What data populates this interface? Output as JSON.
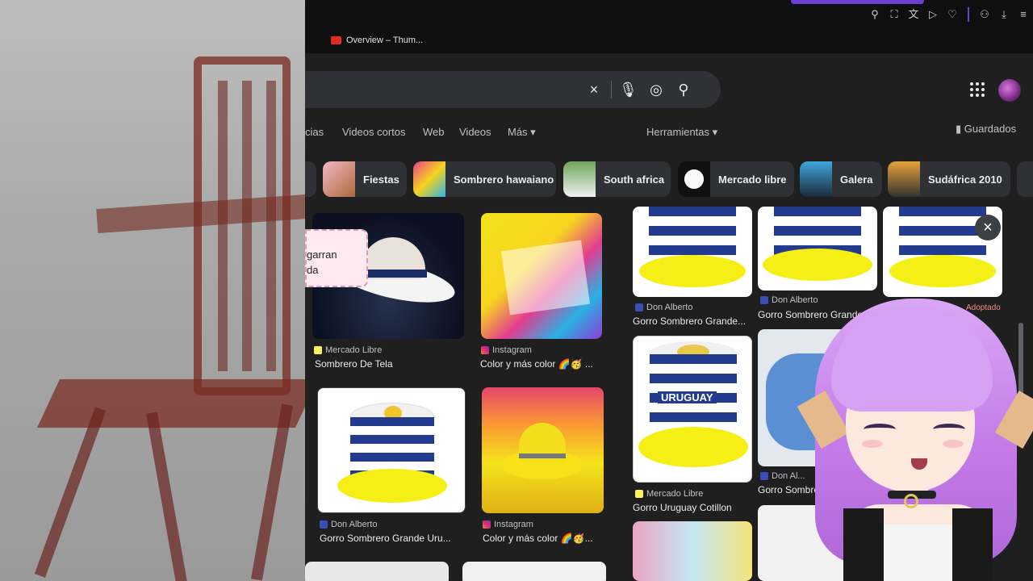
{
  "bookmarks": [
    {
      "label": "Overview – Thum..."
    }
  ],
  "search": {
    "clear_label": "×"
  },
  "nav": {
    "tabs": [
      {
        "label": "cias"
      },
      {
        "label": "Videos cortos"
      },
      {
        "label": "Web"
      },
      {
        "label": "Videos"
      },
      {
        "label": "Más"
      }
    ],
    "tools": "Herramientas",
    "saved": "Guardados"
  },
  "chips": [
    {
      "label": "Fiestas"
    },
    {
      "label": "Sombrero hawaiano"
    },
    {
      "label": "South africa"
    },
    {
      "label": "Mercado libre"
    },
    {
      "label": "Galera"
    },
    {
      "label": "Sudáfrica 2010"
    }
  ],
  "results": [
    {
      "source": "Mercado Libre",
      "title": "Sombrero De Tela"
    },
    {
      "source": "Instagram",
      "title": "Color y más color 🌈🥳 ..."
    },
    {
      "source": "Don Alberto",
      "title": "Gorro Sombrero Grande Uru..."
    },
    {
      "source": "Instagram",
      "title": "Color y más color 🌈🥳..."
    }
  ],
  "overlay_snippet": {
    "line1": "garran",
    "line2": "da"
  },
  "preview": {
    "items": [
      {
        "source": "Don Alberto",
        "title": "Gorro Sombrero Grande..."
      },
      {
        "source": "Don Alberto",
        "title": "Gorro Sombrero Grande ..."
      },
      {
        "source": "Mercado Libre",
        "title": "Gorro Uruguay Cotillon"
      },
      {
        "source": "Don Al...",
        "title": "Gorro Sombrero Grand..."
      }
    ],
    "partial_text": "Adoptado",
    "hat_text": "URUGUAY"
  },
  "colors": {
    "accent": "#6a3fd1",
    "bg": "#1f1f1f",
    "chip": "#303134"
  }
}
